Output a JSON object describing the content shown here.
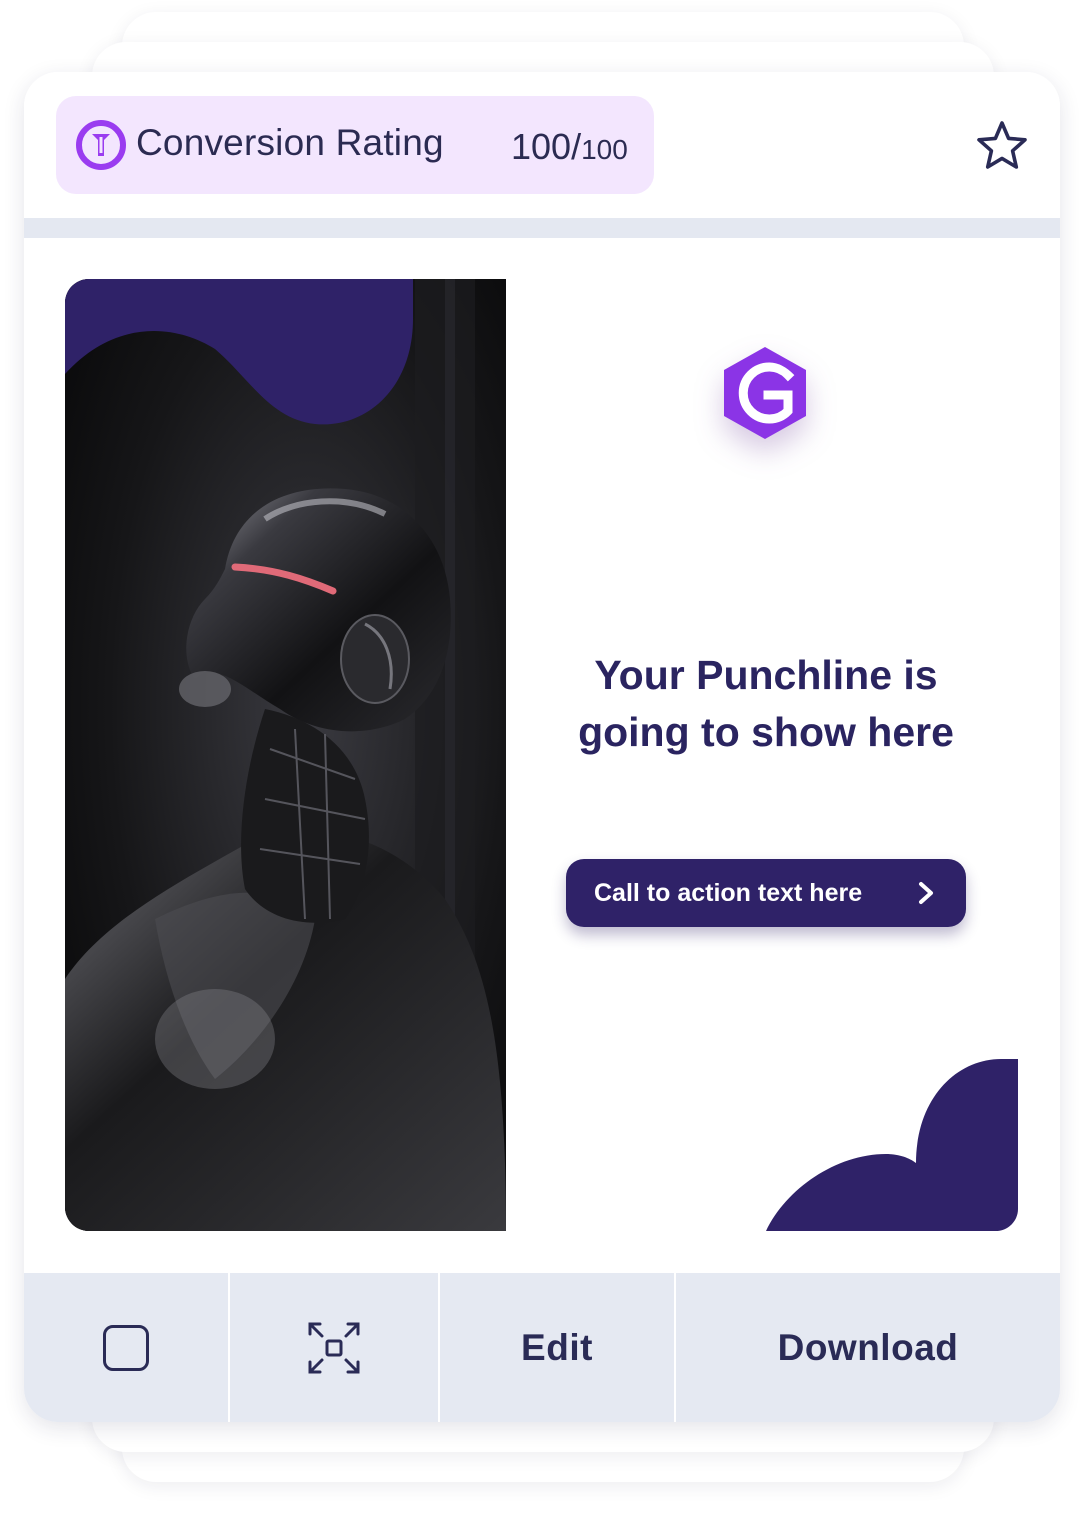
{
  "rating": {
    "label": "Conversion Rating",
    "score": "100/",
    "max": "100",
    "icon": "rating-gauge-icon",
    "pill_color": "#f3e6fe",
    "icon_color": "#9a3cf0"
  },
  "favorite": {
    "icon": "star-outline-icon"
  },
  "ad_preview": {
    "logo_letter": "G",
    "logo_color": "#8b34e6",
    "punchline_line1": "Your Punchline is",
    "punchline_line2": "going to show here",
    "cta_label": "Call to action text here",
    "brand_color": "#2f2268"
  },
  "footer": {
    "select_icon": "checkbox-icon",
    "expand_icon": "expand-icon",
    "edit_label": "Edit",
    "download_label": "Download"
  }
}
